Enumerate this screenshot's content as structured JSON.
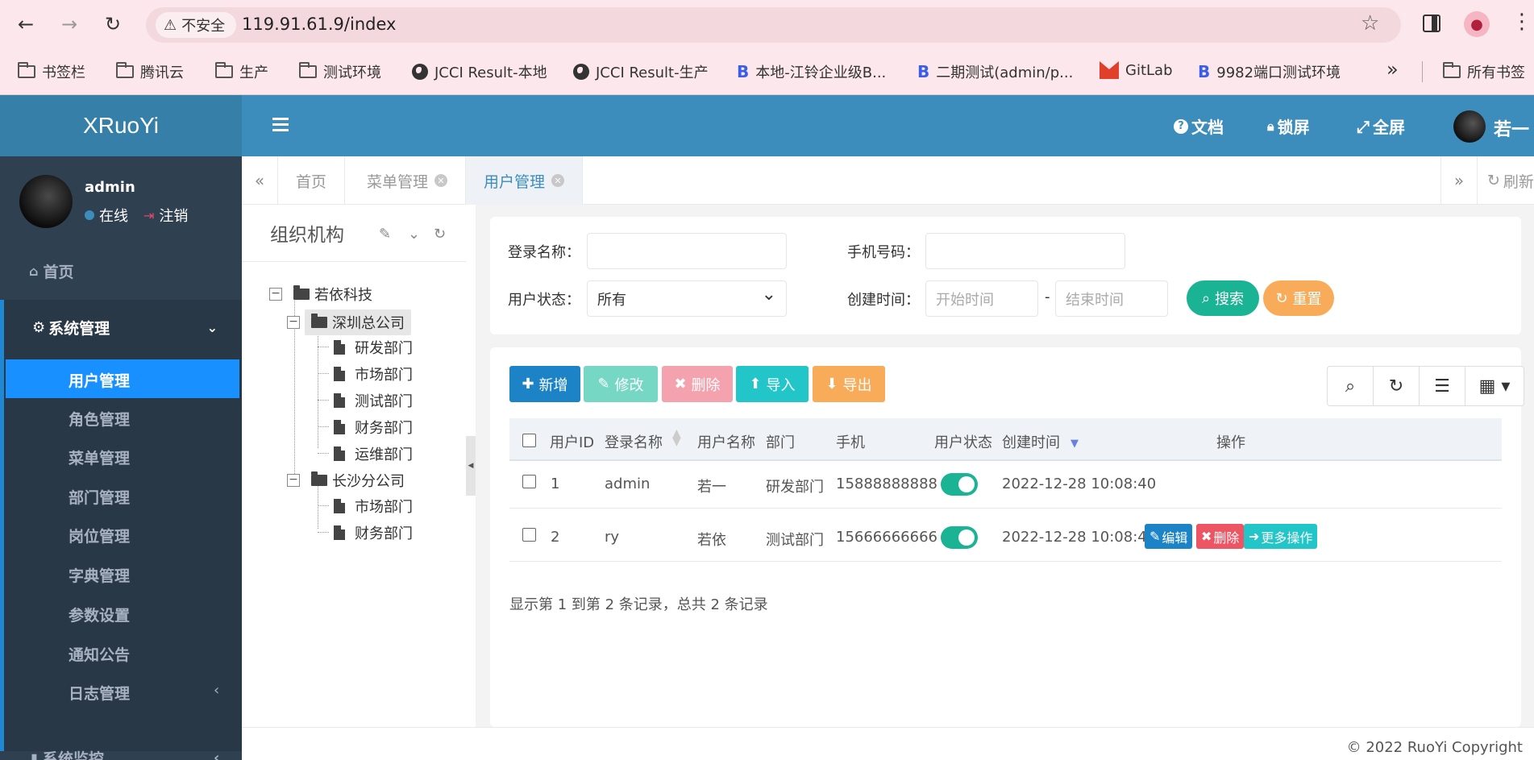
{
  "browser": {
    "security_label": "不安全",
    "url": "119.91.61.9/index",
    "bookmarks": [
      "书签栏",
      "腾讯云",
      "生产",
      "测试环境",
      "JCCI Result-本地",
      "JCCI Result-生产",
      "本地-江铃企业级B...",
      "二期测试(admin/p...",
      "GitLab",
      "9982端口测试环境"
    ],
    "more": "»",
    "all_bookmarks": "所有书签"
  },
  "header": {
    "logo": "XRuoYi",
    "docs": "文档",
    "lock": "锁屏",
    "fullscreen": "全屏",
    "user": "若一"
  },
  "sidebar": {
    "username": "admin",
    "online": "在线",
    "logout": "注销",
    "home": "首页",
    "system": "系统管理",
    "items": [
      "用户管理",
      "角色管理",
      "菜单管理",
      "部门管理",
      "岗位管理",
      "字典管理",
      "参数设置",
      "通知公告",
      "日志管理"
    ],
    "monitor": "系统监控"
  },
  "tabs": {
    "items": [
      "首页",
      "菜单管理",
      "用户管理"
    ],
    "refresh": "刷新"
  },
  "org": {
    "title": "组织机构",
    "root": "若依科技",
    "shenzhen": "深圳总公司",
    "sz_children": [
      "研发部门",
      "市场部门",
      "测试部门",
      "财务部门",
      "运维部门"
    ],
    "changsha": "长沙分公司",
    "cs_children": [
      "市场部门",
      "财务部门"
    ]
  },
  "search": {
    "login_name_label": "登录名称：",
    "phone_label": "手机号码：",
    "status_label": "用户状态：",
    "status_value": "所有",
    "created_label": "创建时间：",
    "start_placeholder": "开始时间",
    "dash": "-",
    "end_placeholder": "结束时间",
    "search_btn": "搜索",
    "reset_btn": "重置"
  },
  "toolbar": {
    "add": "新增",
    "edit": "修改",
    "delete": "删除",
    "import": "导入",
    "export": "导出"
  },
  "table": {
    "headers": [
      "用户ID",
      "登录名称",
      "用户名称",
      "部门",
      "手机",
      "用户状态",
      "创建时间",
      "操作"
    ],
    "rows": [
      {
        "id": "1",
        "login": "admin",
        "name": "若一",
        "dept": "研发部门",
        "phone": "15888888888",
        "status_on": true,
        "created": "2022-12-28 10:08:40"
      },
      {
        "id": "2",
        "login": "ry",
        "name": "若依",
        "dept": "测试部门",
        "phone": "15666666666",
        "status_on": true,
        "created": "2022-12-28 10:08:40"
      }
    ],
    "actions": {
      "edit": "编辑",
      "delete": "删除",
      "more": "更多操作"
    },
    "pager": "显示第 1 到第 2 条记录，总共 2 条记录"
  },
  "footer": {
    "copyright": "© 2022 RuoYi Copyright"
  },
  "colors": {
    "header": "#3c8dbc",
    "sidebar": "#2f4050",
    "active_item": "#1890ff",
    "success": "#1ab394",
    "warning": "#f8ac59",
    "danger": "#ed5565",
    "primary": "#1c84c6",
    "info": "#23c6c8"
  }
}
